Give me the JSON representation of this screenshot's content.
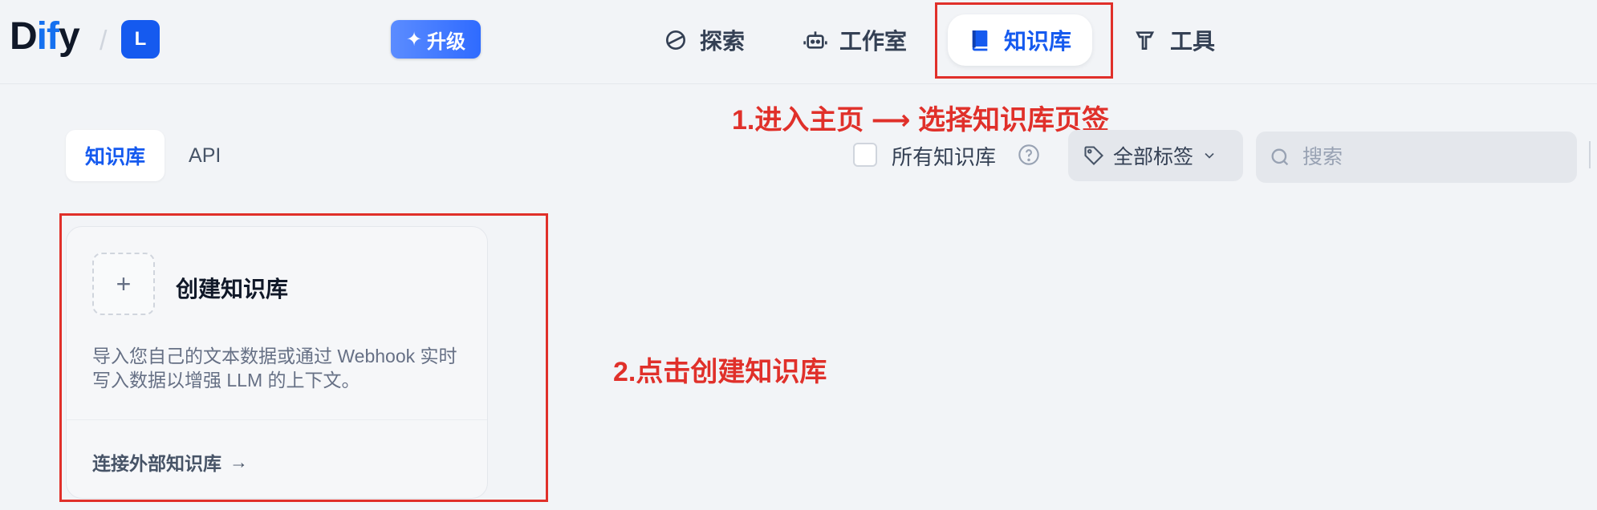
{
  "header": {
    "logo": {
      "part1": "D",
      "part2": "if",
      "part3": "y"
    },
    "separator": "/",
    "workspace_initial": "L",
    "upgrade_label": "升级",
    "nav": [
      {
        "label": "探索",
        "icon": "explore-icon"
      },
      {
        "label": "工作室",
        "icon": "robot-icon"
      },
      {
        "label": "知识库",
        "icon": "book-icon",
        "active": true
      },
      {
        "label": "工具",
        "icon": "hammer-icon"
      }
    ]
  },
  "annotations": {
    "step1": "1.进入主页  ⟶  选择知识库页签",
    "step2": "2.点击创建知识库"
  },
  "tabs": [
    {
      "label": "知识库",
      "active": true
    },
    {
      "label": "API",
      "active": false
    }
  ],
  "filters": {
    "all_datasets_label": "所有知识库",
    "all_datasets_checked": false,
    "tag_filter_label": "全部标签",
    "search_placeholder": "搜索",
    "search_value": ""
  },
  "create_card": {
    "plus": "+",
    "title": "创建知识库",
    "description": "导入您自己的文本数据或通过 Webhook 实时写入数据以增强 LLM 的上下文。",
    "external_link": "连接外部知识库",
    "external_arrow": "→"
  },
  "colors": {
    "accent": "#155aef",
    "annotation_red": "#e0302a",
    "background": "#f2f4f7"
  }
}
